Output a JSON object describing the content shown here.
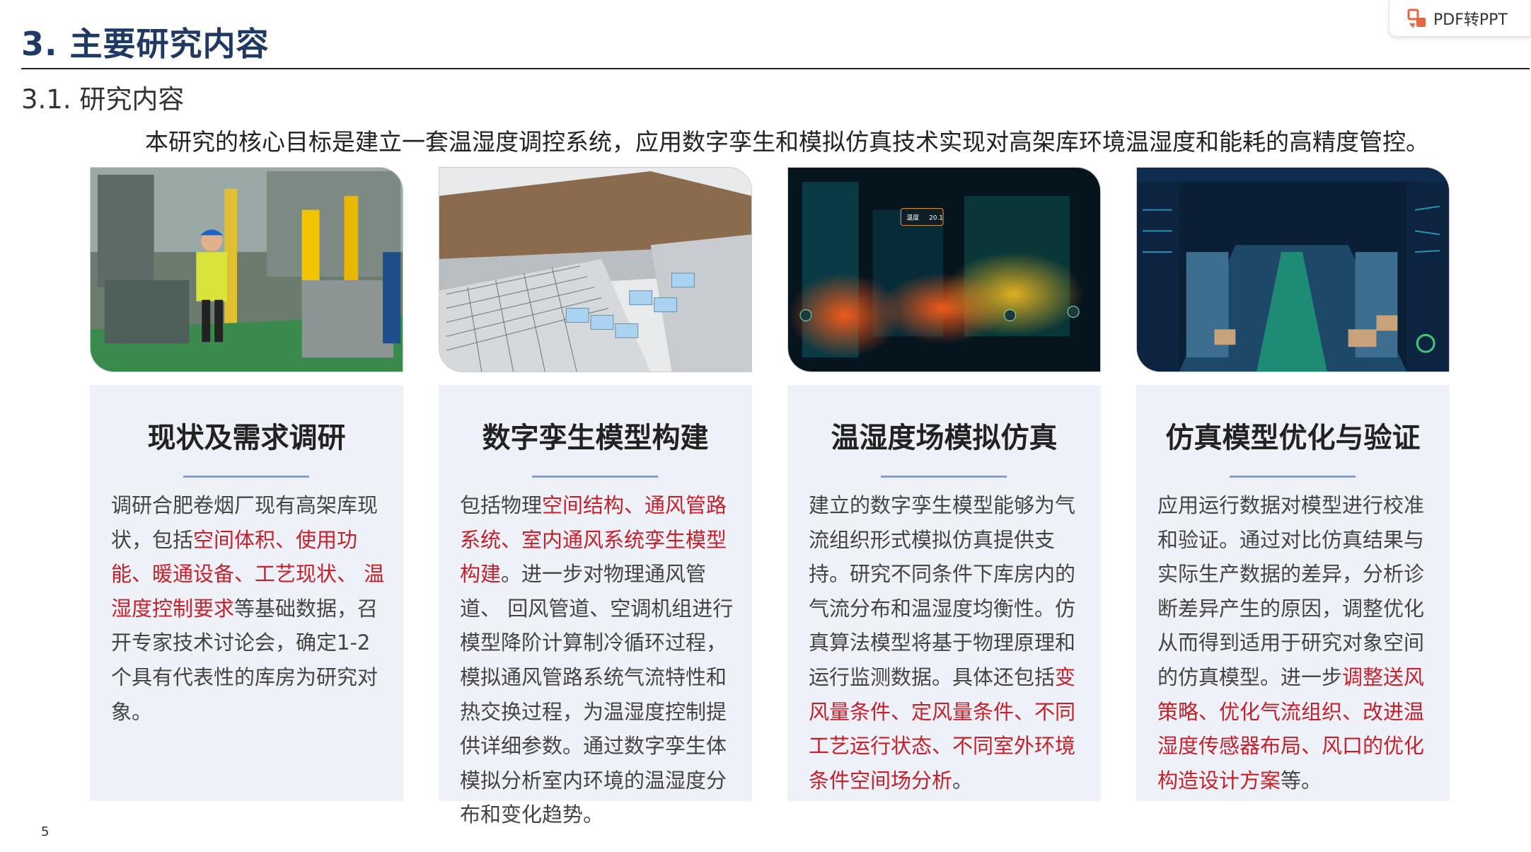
{
  "header": {
    "title": "3. 主要研究内容",
    "subtitle": "3.1. 研究内容"
  },
  "badge": {
    "label": "PDF转PPT"
  },
  "intro": "本研究的核心目标是建立一套温湿度调控系统，应用数字孪生和模拟仿真技术实现对高架库环境温湿度和能耗的高精度管控。",
  "cards": [
    {
      "title": "现状及需求调研",
      "segments": [
        {
          "t": "调研合肥卷烟厂现有高架库现状，包括",
          "hl": false
        },
        {
          "t": "空间体积、使用功能、暖通设备、工艺现状、 温湿度控制要求",
          "hl": true
        },
        {
          "t": "等基础数据，召开专家技术讨论会，确定1-2个具有代表性的库房为研究对象。",
          "hl": false
        }
      ]
    },
    {
      "title": "数字孪生模型构建",
      "segments": [
        {
          "t": "包括物理",
          "hl": false
        },
        {
          "t": "空间结构、通风管路系统、室内通风系统孪生模型构建",
          "hl": true
        },
        {
          "t": "。进一步对物理通风管道、 回风管道、空调机组进行模型降阶计算制冷循环过程，模拟通风管路系统气流特性和热交换过程，为温湿度控制提供详细参数。通过数字孪生体模拟分析室内环境的温湿度分布和变化趋势。",
          "hl": false
        }
      ]
    },
    {
      "title": "温湿度场模拟仿真",
      "segments": [
        {
          "t": "建立的数字孪生模型能够为气流组织形式模拟仿真提供支持。研究不同条件下库房内的气流分布和温湿度均衡性。仿真算法模型将基于物理原理和运行监测数据。具体还包括",
          "hl": false
        },
        {
          "t": "变风量条件、定风量条件、不同工艺运行状态、不同室外环境条件空间场分析",
          "hl": true
        },
        {
          "t": "。",
          "hl": false
        }
      ]
    },
    {
      "title": "仿真模型优化与验证",
      "segments": [
        {
          "t": "应用运行数据对模型进行校准和验证。通过对比仿真结果与实际生产数据的差异，分析诊断差异产生的原因，调整优化从而得到适用于研究对象空间的仿真模型。进一步",
          "hl": false
        },
        {
          "t": "调整送风策略、优化气流组织、改进温湿度传感器布局、风口的优化构造设计方案",
          "hl": true
        },
        {
          "t": "等。",
          "hl": false
        }
      ]
    }
  ],
  "images": {
    "img1": {
      "readout": ""
    },
    "img3": {
      "readout": "20.1",
      "label": "温度"
    }
  },
  "page_number": "5",
  "colors": {
    "title": "#1f3864",
    "highlight": "#c6202b",
    "card_bg": "#eef2f8",
    "card_rule": "#8a9cc7"
  }
}
